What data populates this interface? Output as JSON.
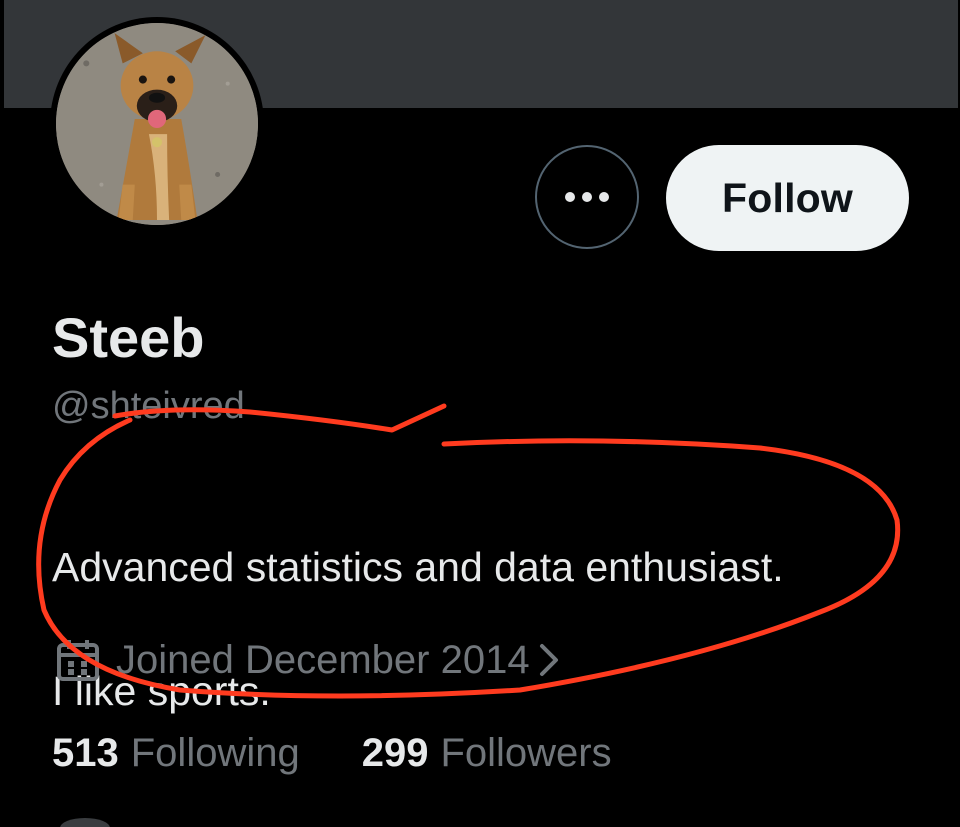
{
  "profile": {
    "display_name": "Steeb",
    "handle": "@shteivred",
    "bio_lines": [
      "Advanced statistics and data enthusiast.",
      "I like sports."
    ],
    "joined": "Joined December 2014",
    "following_count": "513",
    "following_label": "Following",
    "followers_count": "299",
    "followers_label": "Followers"
  },
  "actions": {
    "follow_label": "Follow",
    "more_icon": "more-horizontal-icon"
  },
  "icons": {
    "joined": "calendar-icon",
    "joined_chevron": "chevron-right-icon"
  },
  "colors": {
    "background": "#000000",
    "banner": "#333639",
    "primary_text": "#e7e9ea",
    "secondary_text": "#71767b",
    "follow_button_bg": "#eff3f4",
    "annotation_stroke": "#ff3b1f"
  }
}
